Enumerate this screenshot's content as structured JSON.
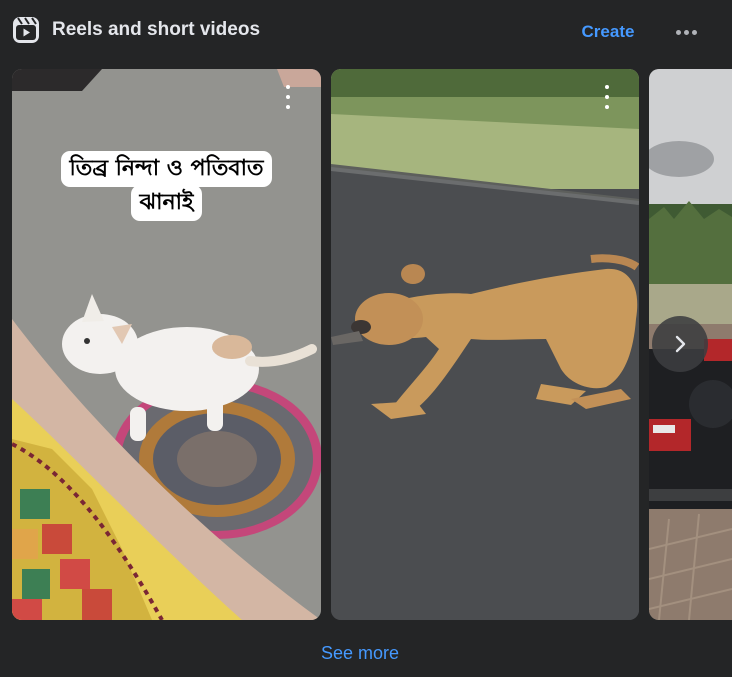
{
  "header": {
    "title": "Reels and short videos",
    "create_label": "Create",
    "icon": "reels-icon",
    "more_icon": "more-horizontal-icon"
  },
  "reels": [
    {
      "caption_lines": [
        "তিব্র নিন্দা ও পতিবাত",
        "ঝানাই"
      ],
      "scene": "white cat on a round woven mat"
    },
    {
      "caption_lines": [],
      "scene": "lion cub on a road"
    },
    {
      "caption_lines": [],
      "scene": "motorcycle near a lake"
    }
  ],
  "next_icon": "chevron-right-icon",
  "footer": {
    "see_more_label": "See more"
  },
  "colors": {
    "background": "#242526",
    "accent": "#4599ff",
    "text": "#e4e6eb"
  }
}
